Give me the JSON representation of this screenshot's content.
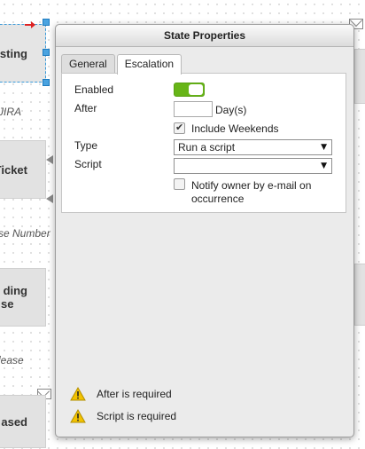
{
  "canvas": {
    "nodes": {
      "testing": "esting",
      "ticket": "Ticket",
      "release_top": "ding",
      "release_bottom": "se",
      "released": "ased"
    },
    "labels": {
      "jira": "JIRA",
      "case_number": "se Number",
      "release": "lease"
    }
  },
  "dialog": {
    "title": "State Properties",
    "tabs": [
      {
        "label": "General"
      },
      {
        "label": "Escalation"
      }
    ],
    "escalation": {
      "enabled_label": "Enabled",
      "after_label": "After",
      "after_value": "",
      "after_unit": "Day(s)",
      "include_weekends_label": "Include Weekends",
      "include_weekends_checked": true,
      "type_label": "Type",
      "type_value": "Run a script",
      "script_label": "Script",
      "script_value": "",
      "notify_label_line1": "Notify owner by e-mail on",
      "notify_label_line2": "occurrence",
      "notify_checked": false
    },
    "warnings": [
      {
        "text": "After is required"
      },
      {
        "text": "Script is required"
      }
    ]
  },
  "colors": {
    "toggle_on": "#67b517",
    "handle": "#4aa3e0",
    "warning": "#f2c200"
  }
}
